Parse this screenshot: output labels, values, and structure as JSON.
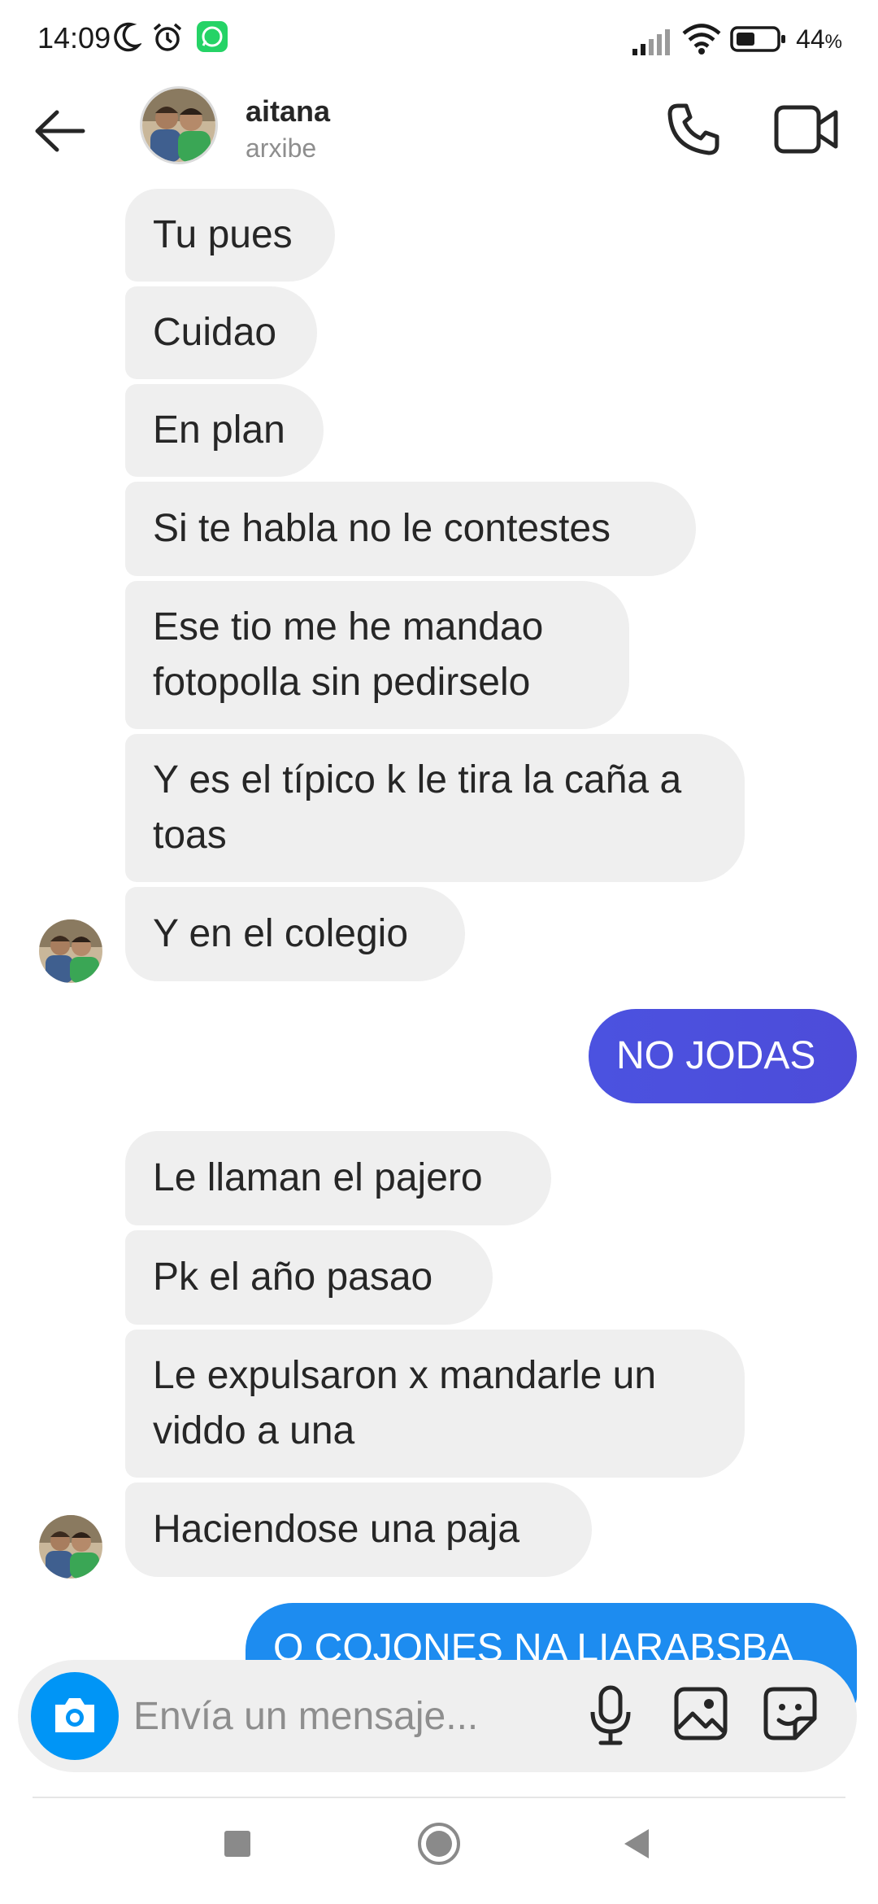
{
  "status_bar": {
    "time": "14:09",
    "battery": "44",
    "battery_unit": "%"
  },
  "header": {
    "name": "aitana",
    "username": "arxibe"
  },
  "messages": [
    {
      "dir": "in",
      "text": "Tu pues"
    },
    {
      "dir": "in",
      "text": "Cuidao"
    },
    {
      "dir": "in",
      "text": "En plan"
    },
    {
      "dir": "in",
      "text": "Si te habla no le contestes"
    },
    {
      "dir": "in",
      "text": "Ese tio me he mandao fotopolla sin pedirselo"
    },
    {
      "dir": "in",
      "text": "Y es el típico k le tira la caña a toas"
    },
    {
      "dir": "in",
      "text": "Y en el colegio"
    },
    {
      "dir": "out",
      "text": "NO JODAS"
    },
    {
      "dir": "in",
      "text": "Le llaman el pajero"
    },
    {
      "dir": "in",
      "text": "Pk el año pasao"
    },
    {
      "dir": "in",
      "text": "Le expulsaron x mandarle un viddo a una"
    },
    {
      "dir": "in",
      "text": "Haciendose una paja"
    },
    {
      "dir": "out",
      "text": "O COJONES NA LIARABSBA"
    }
  ],
  "composer": {
    "placeholder": "Envía un mensaje..."
  },
  "colors": {
    "outgoing_purple": "#4b52e0",
    "outgoing_blue": "#1d8cf0",
    "incoming": "#efefef",
    "accent": "#0095f6"
  },
  "icons": [
    "moon-icon",
    "alarm-icon",
    "whatsapp-icon",
    "signal-icon",
    "wifi-icon",
    "battery-icon",
    "back-arrow-icon",
    "phone-icon",
    "video-icon",
    "camera-icon",
    "microphone-icon",
    "image-icon",
    "sticker-icon",
    "square-nav-icon",
    "circle-nav-icon",
    "triangle-nav-icon"
  ]
}
